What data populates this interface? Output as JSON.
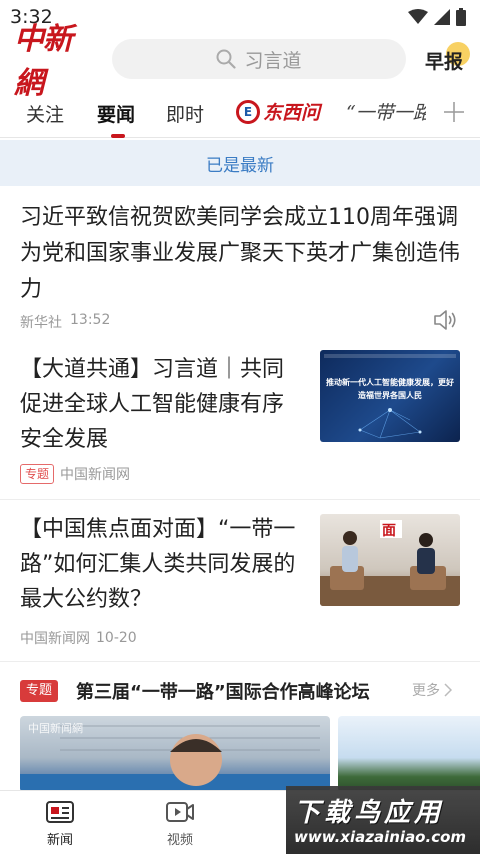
{
  "status": {
    "time": "3:32"
  },
  "header": {
    "logo": "中新網",
    "search_placeholder": "习言道",
    "zaobao_label": "早报"
  },
  "tabs": [
    {
      "label": "关注"
    },
    {
      "label": "要闻",
      "active": true
    },
    {
      "label": "即时"
    },
    {
      "label": "东西问"
    },
    {
      "label": "“一带一路”"
    }
  ],
  "refresh_text": "已是最新",
  "articles": [
    {
      "title": "习近平致信祝贺欧美同学会成立110周年强调 为党和国家事业发展广聚天下英才广集创造伟力",
      "source": "新华社",
      "time": "13:52"
    },
    {
      "title": "【大道共通】习言道｜共同促进全球人工智能健康有序安全发展",
      "badge": "专题",
      "source": "中国新闻网",
      "thumb_text": "推动新一代人工智能健康发展，更好造福世界各国人民"
    },
    {
      "title": "【中国焦点面对面】“一带一路”如何汇集人类共同发展的最大公约数？",
      "source": "中国新闻网",
      "time": "10-20",
      "thumb_logo": "面"
    }
  ],
  "topic": {
    "badge": "专题",
    "title": "第三届“一带一路”国际合作高峰论坛",
    "more": "更多",
    "img_caption": "中国新闻網"
  },
  "bottom_nav": [
    {
      "label": "新闻",
      "active": true
    },
    {
      "label": "视频"
    }
  ],
  "watermark": {
    "title": "下载鸟应用",
    "url": "www.xiazainiao.com"
  },
  "colors": {
    "brand_red": "#c8161d",
    "refresh_blue": "#3b7cc4",
    "refresh_bg": "#e9f0f8"
  }
}
